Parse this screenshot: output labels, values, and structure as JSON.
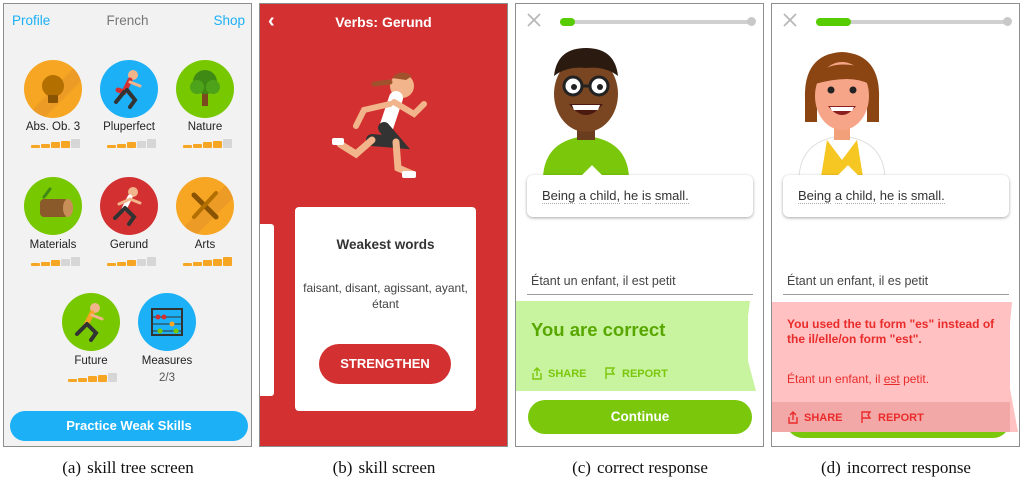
{
  "skill_tree": {
    "profile_label": "Profile",
    "course_title": "French",
    "shop_label": "Shop",
    "skills": [
      {
        "name": "Abs. Ob. 3",
        "icon": "lightbulb-icon",
        "color": "#f6a623",
        "strength": 4,
        "max": 5
      },
      {
        "name": "Pluperfect",
        "icon": "runner-icon",
        "color": "#1cb0f6",
        "strength": 3,
        "max": 5
      },
      {
        "name": "Nature",
        "icon": "tree-icon",
        "color": "#78c800",
        "strength": 4,
        "max": 5
      },
      {
        "name": "Materials",
        "icon": "log-icon",
        "color": "#78c800",
        "strength": 3,
        "max": 5
      },
      {
        "name": "Gerund",
        "icon": "runner-icon",
        "color": "#d33131",
        "strength": 3,
        "max": 5
      },
      {
        "name": "Arts",
        "icon": "brush-icon",
        "color": "#f6a623",
        "strength": 5,
        "max": 5
      },
      {
        "name": "Future",
        "icon": "runner-icon",
        "color": "#78c800",
        "strength": 4,
        "max": 5
      },
      {
        "name": "Measures",
        "icon": "abacus-icon",
        "color": "#1cb0f6",
        "progress_text": "2/3"
      }
    ],
    "practice_button": "Practice Weak Skills"
  },
  "skill_screen": {
    "back_icon": "chevron-left-icon",
    "title": "Verbs: Gerund",
    "weakest_title": "Weakest words",
    "weakest_words": "faisant, disant, agissant, ayant, étant",
    "strengthen_button": "STRENGTHEN"
  },
  "correct_screen": {
    "progress": 0.08,
    "prompt_words": [
      "Being",
      "a",
      "child,",
      "he",
      "is",
      "small."
    ],
    "answer": "Étant un enfant, il est petit",
    "result": "You are correct",
    "share": "SHARE",
    "report": "REPORT",
    "continue_button": "Continue"
  },
  "incorrect_screen": {
    "progress": 0.18,
    "prompt_words": [
      "Being",
      "a",
      "child,",
      "he",
      "is",
      "small."
    ],
    "answer": "Étant un enfant, il es petit",
    "feedback": "You used the tu form \"es\" instead of the il/elle/on form \"est\".",
    "correction_before": "Étant un enfant, il ",
    "correction_error": "est",
    "correction_after": " petit.",
    "share": "SHARE",
    "report": "REPORT"
  },
  "captions": [
    {
      "label": "(a)",
      "text": "skill tree screen"
    },
    {
      "label": "(b)",
      "text": "skill screen"
    },
    {
      "label": "(c)",
      "text": "correct response"
    },
    {
      "label": "(d)",
      "text": "incorrect response"
    }
  ]
}
